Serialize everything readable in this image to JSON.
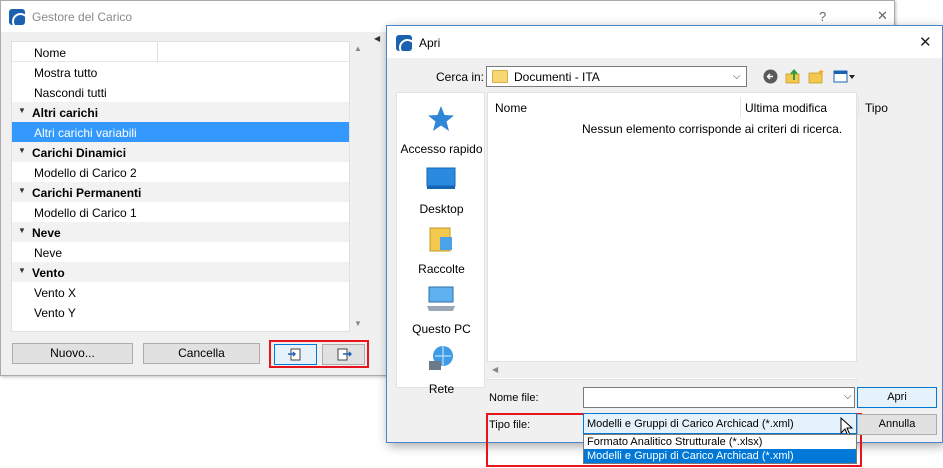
{
  "gestore": {
    "title": "Gestore del Carico",
    "help": "?",
    "minimize": "—",
    "close": "✕",
    "column_header": "Nome",
    "rows": [
      {
        "type": "item",
        "label": "Mostra tutto",
        "selected": false
      },
      {
        "type": "item",
        "label": "Nascondi tutti",
        "selected": false
      },
      {
        "type": "group",
        "label": "Altri carichi",
        "selected": false
      },
      {
        "type": "item",
        "label": "Altri carichi variabili",
        "selected": true
      },
      {
        "type": "group",
        "label": "Carichi Dinamici",
        "selected": false
      },
      {
        "type": "item",
        "label": "Modello di Carico 2",
        "selected": false
      },
      {
        "type": "group",
        "label": "Carichi Permanenti",
        "selected": false
      },
      {
        "type": "item",
        "label": "Modello di Carico 1",
        "selected": false
      },
      {
        "type": "group",
        "label": "Neve",
        "selected": false
      },
      {
        "type": "item",
        "label": "Neve",
        "selected": false
      },
      {
        "type": "group",
        "label": "Vento",
        "selected": false
      },
      {
        "type": "item",
        "label": "Vento X",
        "selected": false
      },
      {
        "type": "item",
        "label": "Vento Y",
        "selected": false
      }
    ],
    "buttons": {
      "new_label": "Nuovo...",
      "delete_label": "Cancella",
      "import_icon": "import-icon",
      "export_icon": "export-icon"
    },
    "highlight_color": "#e8141b"
  },
  "apri": {
    "title": "Apri",
    "close": "✕",
    "look_in_label": "Cerca in:",
    "look_in_value": "Documenti - ITA",
    "toolbar_icons": [
      "back-icon",
      "up-folder-icon",
      "new-folder-icon",
      "view-menu-icon"
    ],
    "places": [
      {
        "label": "Accesso rapido",
        "icon": "quick-access-star-icon"
      },
      {
        "label": "Desktop",
        "icon": "desktop-icon"
      },
      {
        "label": "Raccolte",
        "icon": "libraries-icon"
      },
      {
        "label": "Questo PC",
        "icon": "this-pc-icon"
      },
      {
        "label": "Rete",
        "icon": "network-icon"
      }
    ],
    "columns": [
      "Nome",
      "Ultima modifica",
      "Tipo"
    ],
    "empty_message": "Nessun elemento corrisponde ai criteri di ricerca.",
    "filename_label": "Nome file:",
    "filename_value": "",
    "filetype_label": "Tipo file:",
    "filetype_selected": "Modelli e Gruppi di Carico Archicad (*.xml)",
    "filetype_options": [
      {
        "label": "Formato Analitico Strutturale (*.xlsx)",
        "selected": false
      },
      {
        "label": "Modelli e Gruppi di Carico Archicad (*.xml)",
        "selected": true
      }
    ],
    "open_label": "Apri",
    "cancel_label": "Annulla"
  }
}
